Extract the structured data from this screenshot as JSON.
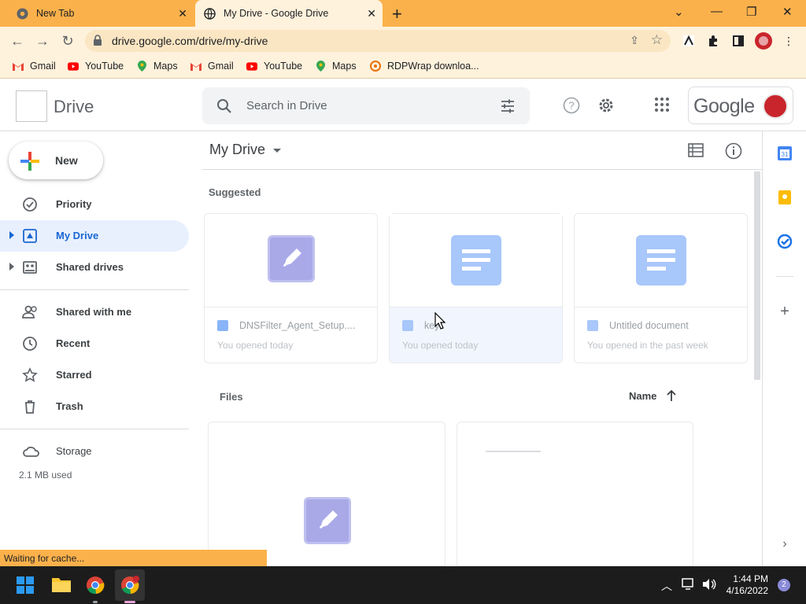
{
  "browser": {
    "tabs": [
      {
        "title": "New Tab"
      },
      {
        "title": "My Drive - Google Drive"
      }
    ],
    "url": "drive.google.com/drive/my-drive",
    "bookmarks": [
      {
        "label": "Gmail",
        "icon": "gmail-icon"
      },
      {
        "label": "YouTube",
        "icon": "youtube-icon"
      },
      {
        "label": "Maps",
        "icon": "maps-icon"
      },
      {
        "label": "Gmail",
        "icon": "gmail-icon"
      },
      {
        "label": "YouTube",
        "icon": "youtube-icon"
      },
      {
        "label": "Maps",
        "icon": "maps-icon"
      },
      {
        "label": "RDPWrap downloa...",
        "icon": "rdpwrap-icon"
      }
    ],
    "status": "Waiting for cache...",
    "accent": "#fbb14b"
  },
  "header": {
    "app_name": "Drive",
    "search_placeholder": "Search in Drive",
    "google_label": "Google"
  },
  "sidebar": {
    "new_label": "New",
    "items": [
      {
        "label": "Priority"
      },
      {
        "label": "My Drive",
        "active": true
      },
      {
        "label": "Shared drives"
      },
      {
        "label": "Shared with me"
      },
      {
        "label": "Recent"
      },
      {
        "label": "Starred"
      },
      {
        "label": "Trash"
      },
      {
        "label": "Storage"
      }
    ],
    "storage_used": "2.1 MB used"
  },
  "main": {
    "title": "My Drive",
    "suggested_label": "Suggested",
    "suggested": [
      {
        "name": "DNSFilter_Agent_Setup....",
        "subtitle": "You opened today",
        "type": "file"
      },
      {
        "name": "key",
        "subtitle": "You opened today",
        "type": "doc"
      },
      {
        "name": "Untitled document",
        "subtitle": "You opened in the past week",
        "type": "doc"
      }
    ],
    "files_label": "Files",
    "sort_label": "Name"
  },
  "taskbar": {
    "time": "1:44 PM",
    "date": "4/16/2022",
    "notifications": "2"
  }
}
